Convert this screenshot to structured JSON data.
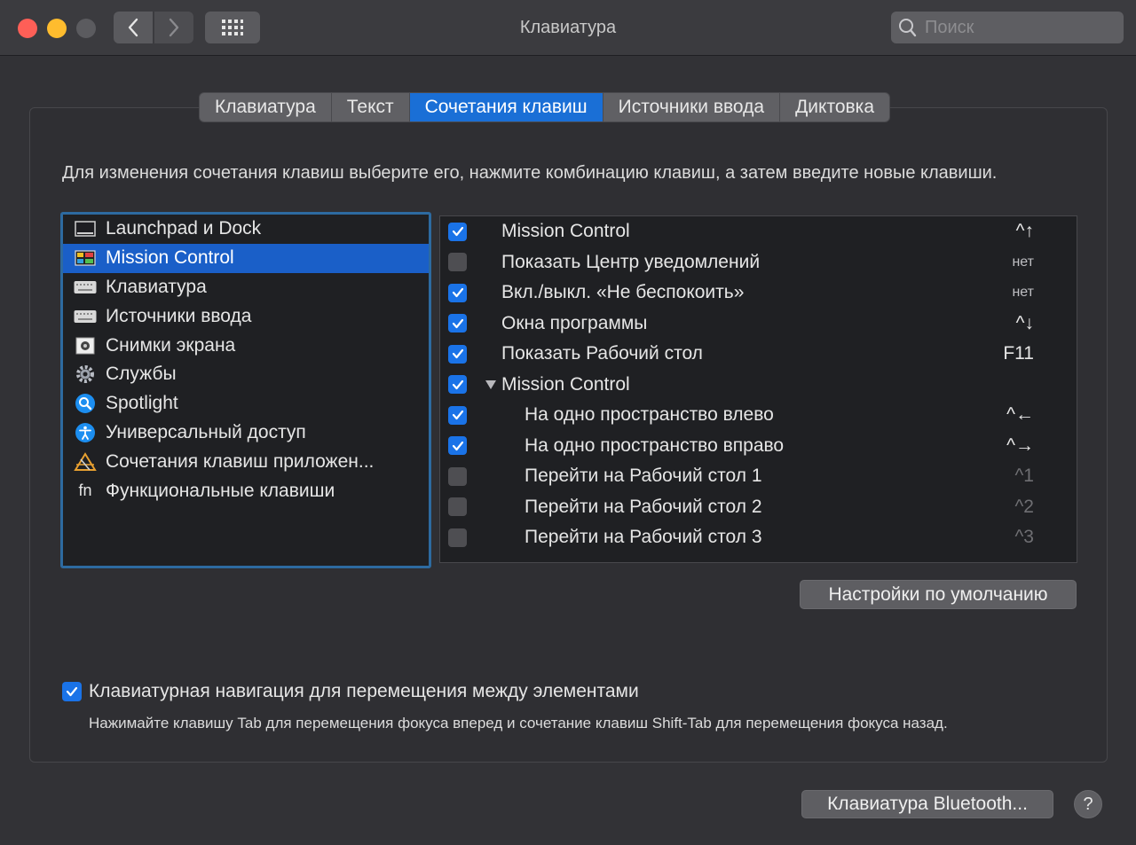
{
  "window": {
    "title": "Клавиатура"
  },
  "toolbar": {
    "back_icon": "chevron-left-icon",
    "forward_icon": "chevron-right-icon",
    "grid_icon": "grid-icon"
  },
  "search": {
    "placeholder": "Поиск"
  },
  "tabs": [
    {
      "label": "Клавиатура",
      "active": false
    },
    {
      "label": "Текст",
      "active": false
    },
    {
      "label": "Сочетания клавиш",
      "active": true
    },
    {
      "label": "Источники ввода",
      "active": false
    },
    {
      "label": "Диктовка",
      "active": false
    }
  ],
  "instruction": "Для изменения сочетания клавиш выберите его, нажмите комбинацию клавиш, а затем введите новые клавиши.",
  "categories": [
    {
      "label": "Launchpad и Dock",
      "icon": "dock-icon"
    },
    {
      "label": "Mission Control",
      "icon": "mission-control-icon",
      "selected": true
    },
    {
      "label": "Клавиатура",
      "icon": "keyboard-icon"
    },
    {
      "label": "Источники ввода",
      "icon": "keyboard-icon"
    },
    {
      "label": "Снимки экрана",
      "icon": "screenshot-icon"
    },
    {
      "label": "Службы",
      "icon": "gear-icon"
    },
    {
      "label": "Spotlight",
      "icon": "spotlight-icon"
    },
    {
      "label": "Универсальный доступ",
      "icon": "accessibility-icon"
    },
    {
      "label": "Сочетания клавиш приложен...",
      "icon": "app-shortcuts-icon"
    },
    {
      "label": "Функциональные клавиши",
      "icon": "fn-icon",
      "icon_text": "fn"
    }
  ],
  "shortcuts": [
    {
      "checked": true,
      "label": "Mission Control",
      "key": "^↑"
    },
    {
      "checked": false,
      "label": "Показать Центр уведомлений",
      "key": "нет",
      "small": true
    },
    {
      "checked": true,
      "label": "Вкл./выкл. «Не беспокоить»",
      "key": "нет",
      "small": true
    },
    {
      "checked": true,
      "label": "Окна программы",
      "key": "^↓"
    },
    {
      "checked": true,
      "label": "Показать Рабочий стол",
      "key": "F11"
    },
    {
      "checked": true,
      "label": "Mission Control",
      "key": "",
      "group": true,
      "expanded": true
    },
    {
      "checked": true,
      "label": "На одно пространство влево",
      "key": "^←",
      "indent": true
    },
    {
      "checked": true,
      "label": "На одно пространство вправо",
      "key": "^→",
      "indent": true
    },
    {
      "checked": false,
      "label": "Перейти на Рабочий стол 1",
      "key": "^1",
      "indent": true,
      "dim": true
    },
    {
      "checked": false,
      "label": "Перейти на Рабочий стол 2",
      "key": "^2",
      "indent": true,
      "dim": true
    },
    {
      "checked": false,
      "label": "Перейти на Рабочий стол 3",
      "key": "^3",
      "indent": true,
      "dim": true
    }
  ],
  "defaults_button": "Настройки по умолчанию",
  "keyboard_nav": {
    "checked": true,
    "label": "Клавиатурная навигация для перемещения между элементами",
    "description": "Нажимайте клавишу Tab для перемещения фокуса вперед и сочетание клавиш Shift-Tab для перемещения фокуса назад."
  },
  "bluetooth_button": "Клавиатура Bluetooth...",
  "help_button": "?"
}
